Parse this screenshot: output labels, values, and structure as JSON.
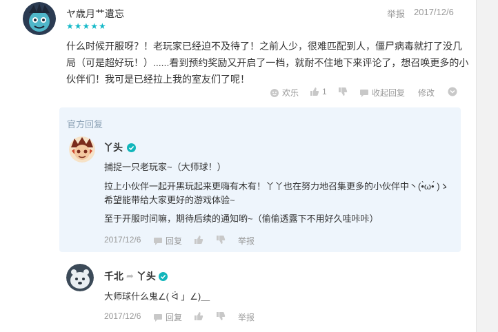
{
  "review": {
    "username": "ヤ歳月艹遺忘",
    "rating_stars": "★★★★★",
    "rating": 5,
    "report_label": "举报",
    "date": "2017/12/6",
    "text": "什么时候开服呀？！老玩家已经迫不及待了！之前人少，很难匹配到人，僵尸病毒就打了没几局（可是超好玩！）......看到预约奖励又开启了一档，就耐不住地下来评论了，想召唤更多的小伙伴们！我可是已经拉上我的室友们了呢！",
    "actions": {
      "mood_label": "欢乐",
      "like_count": "1",
      "collapse_label": "收起回复",
      "edit_label": "修改"
    }
  },
  "official_reply": {
    "title": "官方回复",
    "name": "丫头",
    "paragraphs": [
      "捕捉一只老玩家~（大师球！）",
      "拉上小伙伴一起开黑玩起来更嗨有木有！丫丫也在努力地召集更多的小伙伴中丶(•̀ω•́ )ゝ希望能带给大家更好的游戏体验~",
      "至于开服时间嘛，期待后续的通知哟~（偷偷透露下不用好久哇咔咔）"
    ],
    "date": "2017/12/6",
    "reply_label": "回复",
    "report_label": "举报"
  },
  "comment": {
    "author": "千北",
    "arrow": "➦",
    "target": "丫头",
    "text": "大师球什么鬼∠( ᐛ 」∠)＿",
    "date": "2017/12/6",
    "reply_label": "回复",
    "report_label": "举报"
  },
  "colors": {
    "accent_teal": "#14b9c8",
    "reply_bg": "#eef5fc",
    "muted": "#999999",
    "verified_teal": "#12b6bb"
  }
}
